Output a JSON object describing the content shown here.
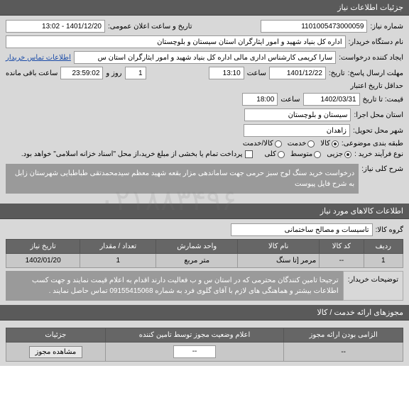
{
  "sections": {
    "need_info": "جزئیات اطلاعات نیاز",
    "goods_info": "اطلاعات کالاهای مورد نیاز",
    "licenses": "مجوزهای ارائه خدمت / کالا"
  },
  "labels": {
    "need_number": "شماره نیاز:",
    "announce_date": "تاریخ و ساعت اعلان عمومی:",
    "buyer_org": "نام دستگاه خریدار:",
    "request_creator": "ایجاد کننده درخواست:",
    "contact_link": "اطلاعات تماس خریدار",
    "send_deadline": "مهلت ارسال پاسخ:",
    "time_label": "ساعت",
    "day_label": "روز و",
    "remaining": "ساعت باقی مانده",
    "history": "تاریخ:",
    "min_credit": "حداقل تاریخ اعتبار",
    "price_until": "قیمت: تا تاریخ",
    "exec_province": "استان محل اجرا:",
    "delivery_city": "شهر محل تحویل:",
    "subject_class": "طبقه بندی موضوعی:",
    "purchase_type": "نوع فرآیند خرید :",
    "purchase_note": "پرداخت تمام یا بخشی از مبلغ خرید،از محل \"اسناد خزانه اسلامی\" خواهد بود.",
    "need_summary": "شرح کلی نیاز:",
    "goods_group": "گروه کالا:",
    "buyer_notes_label": "توضیحات خریدار:"
  },
  "values": {
    "need_number": "1101005473000059",
    "announce_date": "1401/12/20 - 13:02",
    "buyer_org": "اداره کل بنیاد شهید و امور ایثارگران استان سیستان و بلوچستان",
    "request_creator": "سارا کریمی کارشناس اداری مالی اداره کل بنیاد شهید و امور ایثارگران استان س",
    "deadline_date": "1401/12/22",
    "deadline_time": "13:10",
    "remaining_days": "1",
    "remaining_time": "23:59:02",
    "credit_date": "1402/03/31",
    "credit_time": "18:00",
    "exec_province": "سیستان و بلوچستان",
    "delivery_city": "زاهدان",
    "goods_group": "تاسیسات و مصالح ساختمانی",
    "need_summary": "درخواست خرید سنگ لوح سبز حرمی جهت ساماندهی مزار بقعه شهید معظم سیدمحمدتقی طباطبایی شهرستان زابل به شرح فایل پیوست",
    "buyer_notes": "ترجیحا تامین کنندگان محترمی که در استان س و ب فعالیت دارند اقدام به اعلام قیمت نمایند و جهت کسب اطلاعات بیشتر و هماهنگی های لازم با آقای گلوی فرد به شماره 09155415068 تماس حاصل نمایند ."
  },
  "radios": {
    "partial": "جزیی",
    "medium": "متوسط",
    "total": "کلی",
    "goods": "کالا",
    "service": "خدمت",
    "goods_service": "کالا/خدمت"
  },
  "goods_table": {
    "headers": {
      "row": "ردیف",
      "code": "کد کالا",
      "name": "نام کالا",
      "unit": "واحد شمارش",
      "qty": "تعداد / مقدار",
      "date": "تاریخ نیاز"
    },
    "rows": [
      {
        "row": "1",
        "code": "--",
        "name": "مرمر [تا سنگ",
        "unit": "متر مربع",
        "qty": "1",
        "date": "1402/01/20"
      }
    ]
  },
  "license_table": {
    "headers": {
      "mandatory": "الزامی بودن ارائه مجوز",
      "status": "اعلام وضعیت مجوز توسط تامین کننده",
      "details": "جزئیات"
    },
    "rows": [
      {
        "mandatory": "--",
        "status": "--",
        "button": "مشاهده مجوز"
      }
    ]
  },
  "watermark": "۰۲۱۸۸۳۴۹۶"
}
